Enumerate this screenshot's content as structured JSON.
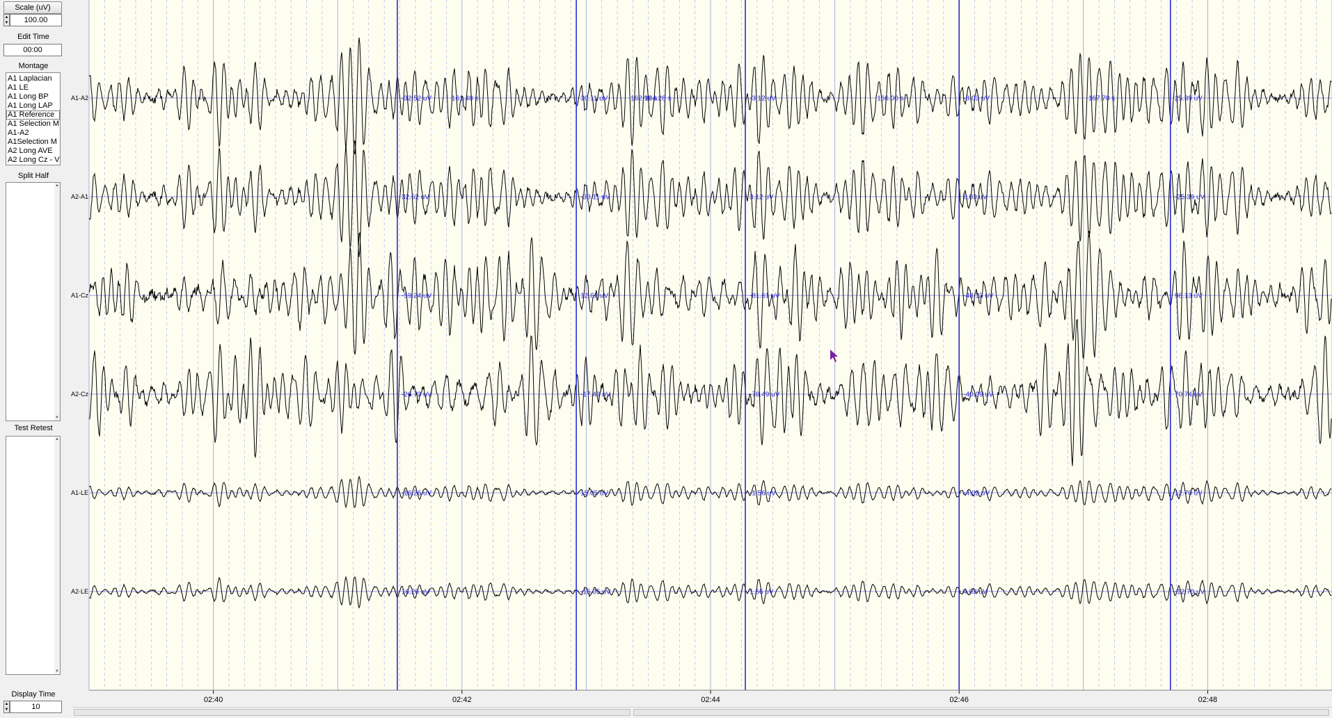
{
  "panel": {
    "scale_label": "Scale (uV)",
    "scale_value": "100.00",
    "edit_time_label": "Edit Time",
    "edit_time_value": "00:00",
    "montage_label": "Montage",
    "montage_items": [
      {
        "label": "A1 Laplacian"
      },
      {
        "label": "A1 LE"
      },
      {
        "label": "A1 Long BP"
      },
      {
        "label": "A1 Long LAP"
      },
      {
        "label": "A1 Reference",
        "selected": true
      },
      {
        "label": "A1 Selection M"
      },
      {
        "label": "A1-A2"
      },
      {
        "label": "A1Selection M"
      },
      {
        "label": "A2 Long AVE"
      },
      {
        "label": "A2 Long Cz - V"
      }
    ],
    "split_half_label": "Split Half",
    "test_retest_label": "Test Retest",
    "display_time_label": "Display Time",
    "display_time_value": "10"
  },
  "eeg": {
    "background": "#fefef0",
    "trace_color": "#000000",
    "marker_color": "#2a2ad6",
    "grid_color": "#9a9ae8",
    "time_ticks": [
      {
        "label": "02:40",
        "t": 160
      },
      {
        "label": "02:42",
        "t": 162
      },
      {
        "label": "02:44",
        "t": 164
      },
      {
        "label": "02:46",
        "t": 166
      },
      {
        "label": "02:48",
        "t": 168
      }
    ],
    "time_range": [
      159.0,
      169.0
    ],
    "markers_t": [
      161.48,
      162.92,
      164.28,
      166.0,
      167.7
    ],
    "marker_time_labels": [
      {
        "after_channel": 0,
        "t": 161.48,
        "label": "161.48 s"
      },
      {
        "after_channel": 0,
        "t": 162.92,
        "label": "162.92 s"
      },
      {
        "after_channel": 0,
        "t": 163.55,
        "label": "164.28 s"
      },
      {
        "after_channel": 0,
        "t": 166.0,
        "label": "166.00 s"
      },
      {
        "after_channel": 0,
        "t": 167.7,
        "label": "167.70 s"
      }
    ],
    "channels": [
      {
        "name": "A1-A2",
        "amp": 1.0,
        "values": [
          "-32.52 uV",
          "30.11 uV",
          "-3.12 uV",
          "-8.03 uV",
          "25.39 uV"
        ]
      },
      {
        "name": "A2-A1",
        "amp": 1.0,
        "values": [
          "32.52 uV",
          "-30.11 uV",
          "3.12 uV",
          "8.03 uV",
          "-25.39 uV"
        ]
      },
      {
        "name": "A1-Cz",
        "amp": 1.25,
        "values": [
          "-59.24 uV",
          "12.62 uV",
          "-81.61 uV",
          "-48.13 uV",
          "96.13 uV"
        ]
      },
      {
        "name": "A2-Cz",
        "amp": 1.2,
        "values": [
          "-26.73 uV",
          "-17.49 uV",
          "-78.49 uV",
          "-40.09 uV",
          "70.74 uV"
        ]
      },
      {
        "name": "A1-LE",
        "amp": 0.5,
        "values": [
          "-16.26 uV",
          "15.05 uV",
          "-1.56 uV",
          "-4.02 uV",
          "12.70 uV"
        ]
      },
      {
        "name": "A2-LE",
        "amp": 0.5,
        "values": [
          "16.26 uV",
          "-15.05 uV",
          "1.56 uV",
          "4.02 uV",
          "-12.70 uV"
        ]
      }
    ]
  }
}
